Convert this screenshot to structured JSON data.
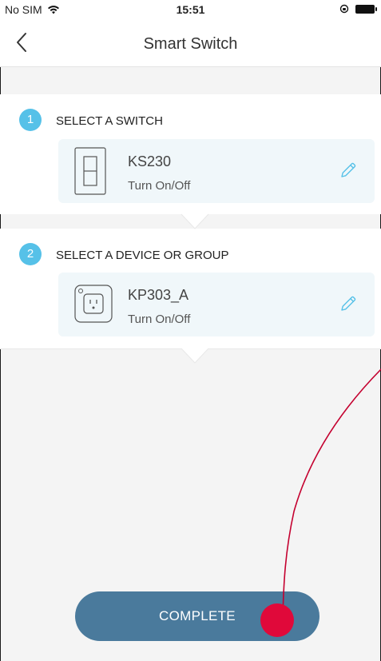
{
  "status_bar": {
    "carrier": "No SIM",
    "time": "15:51"
  },
  "nav": {
    "title": "Smart Switch"
  },
  "steps": [
    {
      "number": "1",
      "label": "SELECT A SWITCH",
      "device": {
        "name": "KS230",
        "action": "Turn On/Off",
        "icon": "wall-switch-icon"
      }
    },
    {
      "number": "2",
      "label": "SELECT A DEVICE OR GROUP",
      "device": {
        "name": "KP303_A",
        "action": "Turn On/Off",
        "icon": "smart-plug-icon"
      }
    }
  ],
  "complete_button": {
    "label": "COMPLETE"
  },
  "colors": {
    "accent": "#56c1e8",
    "button": "#4a7a9c",
    "annotation": "#e0093a"
  }
}
